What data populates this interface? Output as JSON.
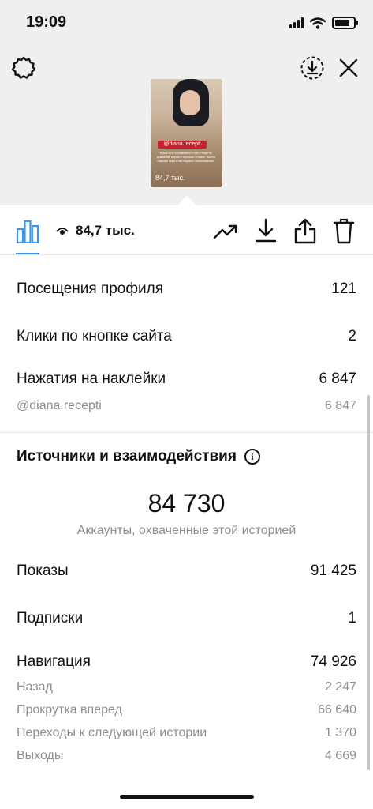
{
  "status_bar": {
    "time": "19:09"
  },
  "story": {
    "sticker": "@diana.recepti",
    "caption": "Я вам хочу познакомить с ней ! Рецепты, домашние и просто хорошая человек. Частно говоря я сама к ней недавно познакомилась.",
    "views_overlay": "84,7 тыс."
  },
  "toolbar": {
    "views": "84,7 тыс."
  },
  "stats": [
    {
      "label": "Посещения профиля",
      "value": "121"
    },
    {
      "label": "Клики по кнопке сайта",
      "value": "2"
    },
    {
      "label": "Нажатия на наклейки",
      "value": "6 847"
    },
    {
      "label": "@diana.recepti",
      "value": "6 847"
    }
  ],
  "sources": {
    "title": "Источники и взаимодействия",
    "info_symbol": "i",
    "reach": "84 730",
    "reach_label": "Аккаунты, охваченные этой историей",
    "impressions": {
      "label": "Показы",
      "value": "91 425"
    },
    "follows": {
      "label": "Подписки",
      "value": "1"
    },
    "navigation": {
      "label": "Навигация",
      "value": "74 926"
    },
    "navigation_items": [
      {
        "label": "Назад",
        "value": "2 247"
      },
      {
        "label": "Прокрутка вперед",
        "value": "66 640"
      },
      {
        "label": "Переходы к следующей истории",
        "value": "1 370"
      },
      {
        "label": "Выходы",
        "value": "4 669"
      }
    ]
  },
  "colors": {
    "accent": "#3897f0",
    "sticker_red": "#c8202d",
    "muted_text": "#8e8e8e"
  }
}
